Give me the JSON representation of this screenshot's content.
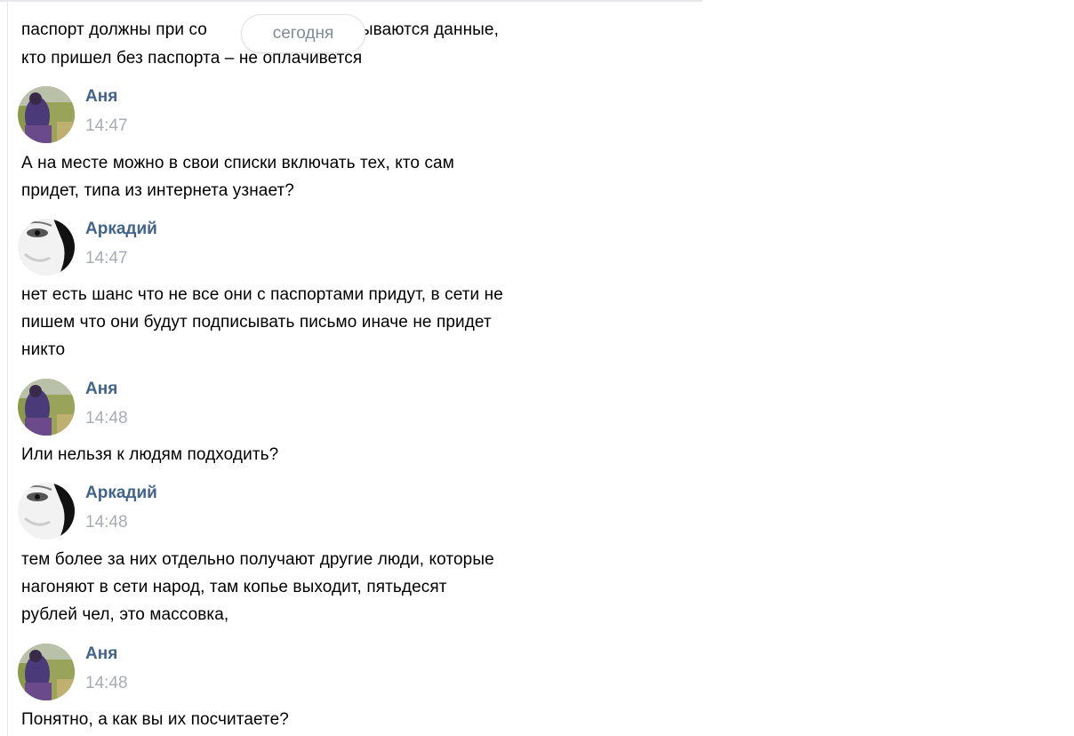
{
  "date_divider": "сегодня",
  "first_message": {
    "line1_before": "паспорт должны при со",
    "line1_after": "вписываются данные,",
    "line2": "кто пришел без паспорта – не оплачивется"
  },
  "messages": [
    {
      "author": "Аня",
      "time": "14:47",
      "avatar_icon": "anya-avatar",
      "lines": [
        "А на месте можно в свои списки включать тех, кто сам",
        "придет, типа из интернета узнает?"
      ]
    },
    {
      "author": "Аркадий",
      "time": "14:47",
      "avatar_icon": "arkadiy-avatar",
      "lines": [
        "нет есть шанс что не все они с паспортами придут, в сети не",
        "пишем что они будут подписывать письмо иначе не придет",
        "никто"
      ]
    },
    {
      "author": "Аня",
      "time": "14:48",
      "avatar_icon": "anya-avatar",
      "lines": [
        "Или нельзя к людям подходить?"
      ]
    },
    {
      "author": "Аркадий",
      "time": "14:48",
      "avatar_icon": "arkadiy-avatar",
      "lines": [
        "тем более за них отдельно получают другие люди, которые",
        "нагоняют в сети народ, там копье выходит, пятьдесят",
        "рублей чел, это массовка,"
      ]
    },
    {
      "author": "Аня",
      "time": "14:48",
      "avatar_icon": "anya-avatar",
      "lines": [
        "Понятно, а как вы их посчитаете?"
      ]
    }
  ],
  "colors": {
    "author_link": "#42648b",
    "timestamp": "#a8acb3",
    "date_pill_text": "#818c99"
  }
}
